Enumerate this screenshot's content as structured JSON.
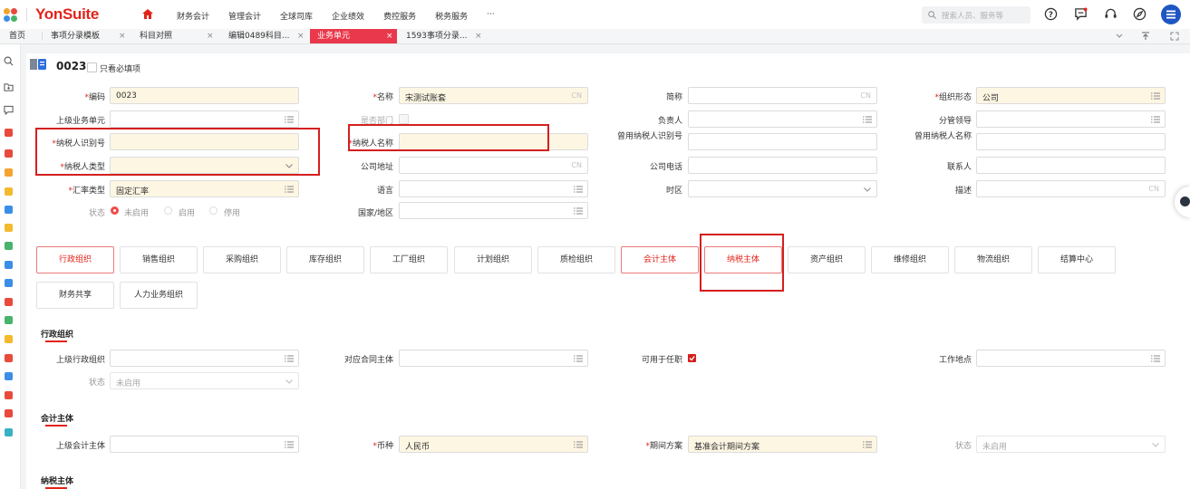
{
  "brand": {
    "name": "YonSuite"
  },
  "nav": {
    "items": [
      "财务会计",
      "管理会计",
      "全球司库",
      "企业绩效",
      "费控服务",
      "税务服务",
      "···"
    ]
  },
  "search": {
    "placeholder": "搜索人员、服务等"
  },
  "tabs": [
    {
      "label": "首页"
    },
    {
      "label": "事项分录模板"
    },
    {
      "label": "科目对照"
    },
    {
      "label": "编辑0489科目..."
    },
    {
      "label": "业务单元"
    },
    {
      "label": "1593事项分录..."
    }
  ],
  "close_glyph": "×",
  "header": {
    "code": "0023",
    "only_required": "只看必填项"
  },
  "fields": {
    "code": {
      "label": "编码",
      "value": "0023"
    },
    "name": {
      "label": "名称",
      "value": "宋测试账套",
      "suffix": "CN"
    },
    "short_name": {
      "label": "简称",
      "suffix": "CN"
    },
    "org_form": {
      "label": "组织形态",
      "value": "公司"
    },
    "parent_unit": {
      "label": "上级业务单元"
    },
    "is_department": {
      "label": "是否部门"
    },
    "manager": {
      "label": "负责人"
    },
    "leader": {
      "label": "分管领导"
    },
    "taxpayer_id": {
      "label": "纳税人识别号"
    },
    "taxpayer_name": {
      "label": "纳税人名称"
    },
    "former_taxpayer_id": {
      "label": "曾用纳税人识别号"
    },
    "former_taxpayer_name": {
      "label": "曾用纳税人名称"
    },
    "taxpayer_type": {
      "label": "纳税人类型"
    },
    "company_address": {
      "label": "公司地址",
      "suffix": "CN"
    },
    "company_phone": {
      "label": "公司电话"
    },
    "contact": {
      "label": "联系人"
    },
    "rate_type": {
      "label": "汇率类型",
      "value": "固定汇率"
    },
    "language": {
      "label": "语言"
    },
    "timezone": {
      "label": "时区"
    },
    "description": {
      "label": "描述",
      "suffix": "CN"
    },
    "status": {
      "label": "状态",
      "options": [
        "未启用",
        "启用",
        "停用"
      ]
    },
    "country": {
      "label": "国家/地区"
    }
  },
  "org_buttons_row1": [
    "行政组织",
    "销售组织",
    "采购组织",
    "库存组织",
    "工厂组织",
    "计划组织",
    "质检组织",
    "会计主体",
    "纳税主体",
    "资产组织",
    "维修组织",
    "物流组织",
    "结算中心"
  ],
  "org_buttons_row2": [
    "财务共享",
    "人力业务组织"
  ],
  "admin_section": {
    "title": "行政组织",
    "parent_admin": {
      "label": "上级行政组织"
    },
    "contract_entity": {
      "label": "对应合同主体"
    },
    "for_appointment": {
      "label": "可用于任职",
      "checked": true
    },
    "work_location": {
      "label": "工作地点"
    },
    "status": {
      "label": "状态",
      "value": "未启用"
    }
  },
  "acct_section": {
    "title": "会计主体",
    "parent_entity": {
      "label": "上级会计主体"
    },
    "currency": {
      "label": "币种",
      "value": "人民币"
    },
    "period_scheme": {
      "label": "期间方案",
      "value": "基准会计期间方案"
    },
    "status": {
      "label": "状态",
      "value": "未启用"
    }
  },
  "tax_section": {
    "title": "纳税主体"
  },
  "colors": {
    "accent": "#e2231a",
    "required_bg": "#fdf6e3",
    "active_tab": "#e9384b"
  }
}
